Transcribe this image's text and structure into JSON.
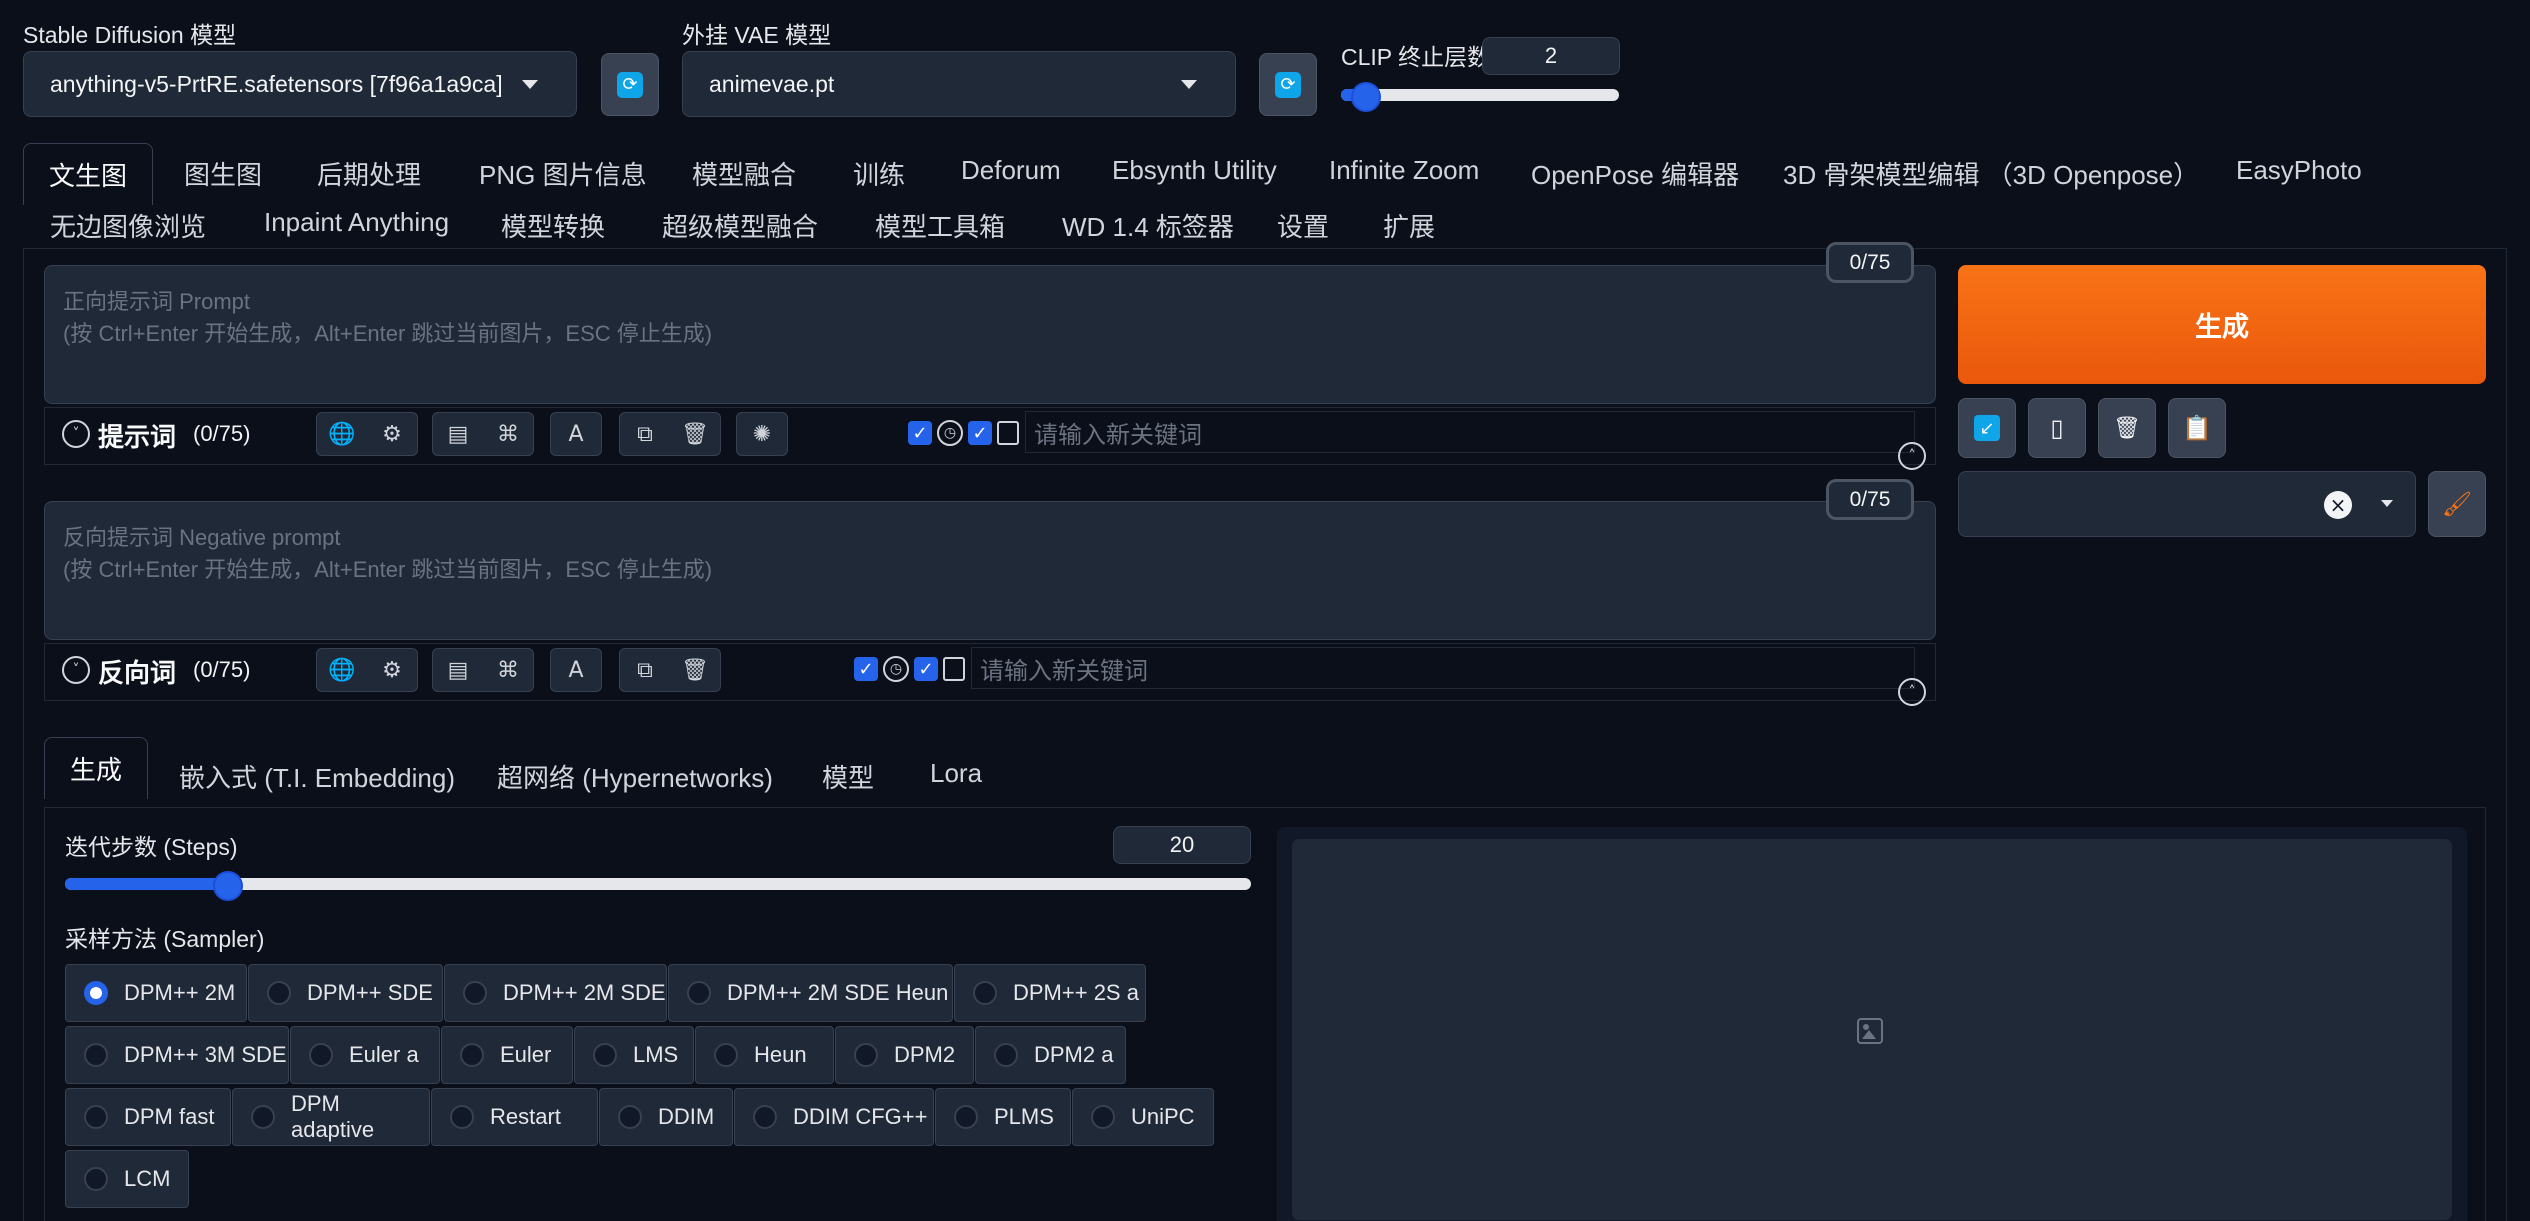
{
  "top": {
    "sd_model_label": "Stable Diffusion 模型",
    "sd_model_value": "anything-v5-PrtRE.safetensors [7f96a1a9ca]",
    "vae_label": "外挂 VAE 模型",
    "vae_value": "animevae.pt",
    "clip_label": "CLIP 终止层数",
    "clip_value": "2",
    "clip_fraction": 0.083
  },
  "main_tabs": [
    {
      "label": "文生图"
    },
    {
      "label": "图生图"
    },
    {
      "label": "后期处理"
    },
    {
      "label": "PNG 图片信息"
    },
    {
      "label": "模型融合"
    },
    {
      "label": "训练"
    },
    {
      "label": "Deforum"
    },
    {
      "label": "Ebsynth Utility"
    },
    {
      "label": "Infinite Zoom"
    },
    {
      "label": "OpenPose 编辑器"
    },
    {
      "label": "3D 骨架模型编辑 （3D Openpose）"
    },
    {
      "label": "EasyPhoto"
    },
    {
      "label": "无边图像浏览"
    },
    {
      "label": "Inpaint Anything"
    },
    {
      "label": "模型转换"
    },
    {
      "label": "超级模型融合"
    },
    {
      "label": "模型工具箱"
    },
    {
      "label": "WD 1.4 标签器"
    },
    {
      "label": "设置"
    },
    {
      "label": "扩展"
    }
  ],
  "prompt": {
    "placeholder_line1": "正向提示词 Prompt",
    "placeholder_line2": "(按 Ctrl+Enter 开始生成，Alt+Enter 跳过当前图片，ESC 停止生成)",
    "counter": "0/75",
    "toolbar_title": "提示词",
    "toolbar_count": "(0/75)",
    "keyword_placeholder": "请输入新关键词"
  },
  "negative": {
    "placeholder_line1": "反向提示词 Negative prompt",
    "placeholder_line2": "(按 Ctrl+Enter 开始生成，Alt+Enter 跳过当前图片，ESC 停止生成)",
    "counter": "0/75",
    "toolbar_title": "反向词",
    "toolbar_count": "(0/75)",
    "keyword_placeholder": "请输入新关键词"
  },
  "generate_label": "生成",
  "sub_tabs": [
    {
      "label": "生成"
    },
    {
      "label": "嵌入式 (T.I. Embedding)"
    },
    {
      "label": "超网络 (Hypernetworks)"
    },
    {
      "label": "模型"
    },
    {
      "label": "Lora"
    }
  ],
  "steps": {
    "label": "迭代步数 (Steps)",
    "value": "20",
    "fraction": 0.136
  },
  "sampler": {
    "label": "采样方法 (Sampler)",
    "selected": "DPM++ 2M",
    "options": [
      "DPM++ 2M",
      "DPM++ SDE",
      "DPM++ 2M SDE",
      "DPM++ 2M SDE Heun",
      "DPM++ 2S a",
      "DPM++ 3M SDE",
      "Euler a",
      "Euler",
      "LMS",
      "Heun",
      "DPM2",
      "DPM2 a",
      "DPM fast",
      "DPM adaptive",
      "Restart",
      "DDIM",
      "DDIM CFG++",
      "PLMS",
      "UniPC",
      "LCM"
    ]
  },
  "colors": {
    "accent": "#2563eb",
    "generate": "#f97316",
    "background": "#0b0f19"
  }
}
